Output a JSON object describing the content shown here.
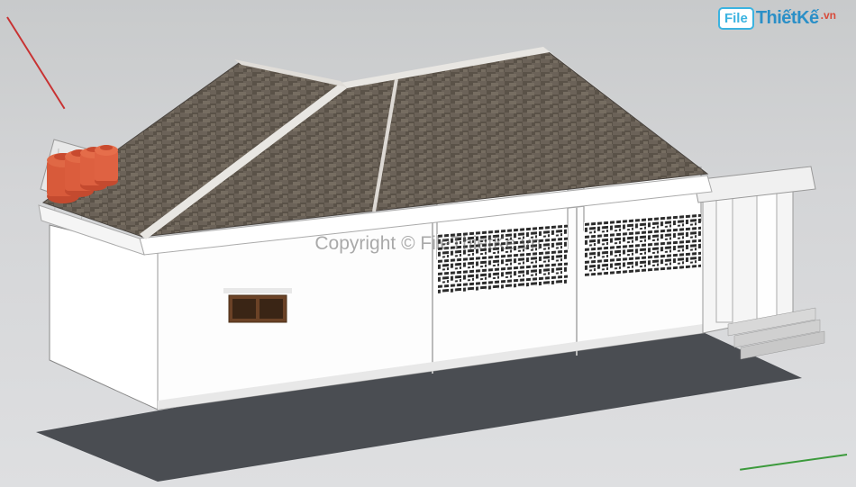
{
  "logo": {
    "file_text": "File",
    "brand_text": "ThiếtKế",
    "tld_text": ".vn"
  },
  "watermark": {
    "text": "Copyright © FileThietKe.vn"
  },
  "axes": {
    "red": "x-axis",
    "green": "y-axis"
  },
  "model": {
    "type": "single-story-house",
    "roof_style": "hip-roof",
    "roof_material": "shingle-gray-brown",
    "wall_color": "#ffffff",
    "features": {
      "water_tanks": {
        "count": 4,
        "color": "#d85a3a",
        "position": "rear-roof-platform"
      },
      "window": {
        "type": "small-double",
        "frame_color": "#8b5a2b",
        "position": "side-wall"
      },
      "decorative_panels": {
        "count": 2,
        "pattern": "geometric-lattice",
        "position": "front-upper-wall"
      },
      "entrance": {
        "porch": true,
        "columns": 2,
        "steps": 3,
        "position": "front-right"
      }
    }
  }
}
